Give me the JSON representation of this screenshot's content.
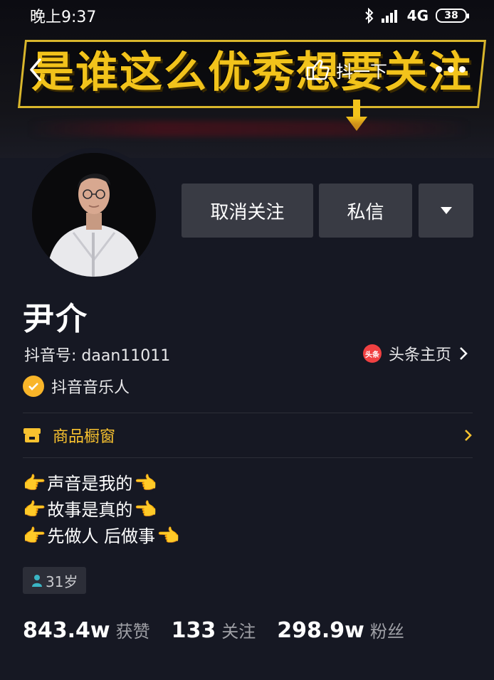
{
  "status_bar": {
    "time": "晚上9:37",
    "network": "4G",
    "battery": "38",
    "icons": [
      "bluetooth-icon",
      "signal-icon",
      "battery-icon"
    ]
  },
  "cover": {
    "slogan": "是谁这么优秀想要关注我",
    "accent_color": "#f2c31b"
  },
  "nav": {
    "share_label": "抖一下"
  },
  "actions": {
    "unfollow_label": "取消关注",
    "message_label": "私信"
  },
  "profile": {
    "name": "尹介",
    "douyin_id": "抖音号: daan11011",
    "toutiao_icon_text": "头条",
    "toutiao_label": "头条主页",
    "verified_label": "抖音音乐人",
    "shop_label": "商品橱窗",
    "bio": [
      "声音是我的",
      "故事是真的",
      "先做人 后做事"
    ],
    "age": "31岁"
  },
  "stats": [
    {
      "value": "843.4w",
      "label": "获赞"
    },
    {
      "value": "133",
      "label": "关注"
    },
    {
      "value": "298.9w",
      "label": "粉丝"
    }
  ],
  "colors": {
    "background": "#161823",
    "button": "#393b44",
    "shop": "#f9c22f",
    "verified": "#f9b529"
  }
}
